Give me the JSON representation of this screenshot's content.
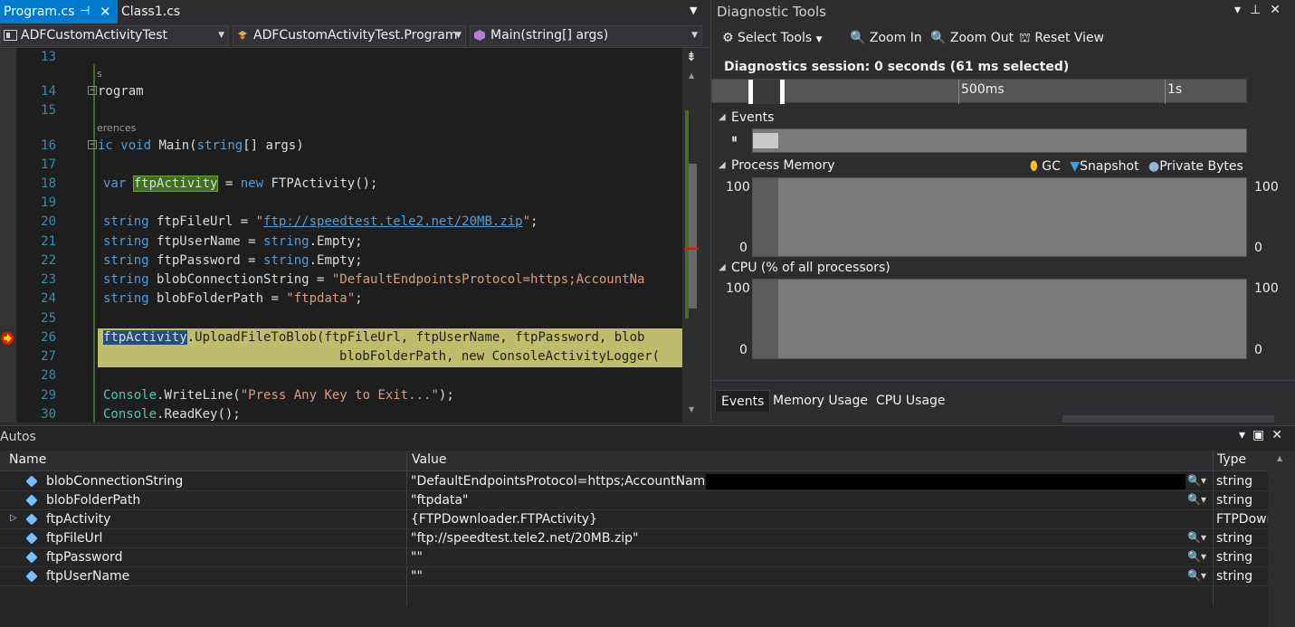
{
  "editor": {
    "tabs": [
      {
        "label": "Program.cs",
        "active": true
      },
      {
        "label": "Class1.cs",
        "active": false
      }
    ],
    "nav": {
      "project": "ADFCustomActivityTest",
      "class": "ADFCustomActivityTest.Program",
      "member": "Main(string[] args)"
    },
    "lines": [
      {
        "no": "13"
      },
      {
        "no": "14"
      },
      {
        "no": "15"
      },
      {
        "no": "16"
      },
      {
        "no": "17"
      },
      {
        "no": "18"
      },
      {
        "no": "19"
      },
      {
        "no": "20"
      },
      {
        "no": "21"
      },
      {
        "no": "22"
      },
      {
        "no": "23"
      },
      {
        "no": "24"
      },
      {
        "no": "25"
      },
      {
        "no": "26"
      },
      {
        "no": "27"
      },
      {
        "no": "28"
      },
      {
        "no": "29"
      },
      {
        "no": "30"
      }
    ],
    "code": {
      "l13_frag": "s",
      "l14": "rogram",
      "refs_frag": "erences",
      "l16_kw1": "ic",
      "l16_kw2": "void",
      "l16_rest": "Main(",
      "l16_kw3": "string",
      "l16_end": "[] args)",
      "l18_var": "var",
      "l18_id": "ftpActivity",
      "l18_eq": " = ",
      "l18_new": "new",
      "l18_rest": " FTPActivity();",
      "string_kw": "string",
      "l20_name": " ftpFileUrl = ",
      "l20_q1": "\"",
      "l20_url": "ftp://speedtest.tele2.net/20MB.zip",
      "l20_q2": "\"",
      "l20_end": ";",
      "l21_name": " ftpUserName = ",
      "l21_kw": "string",
      "l21_end": ".Empty;",
      "l22_name": " ftpPassword = ",
      "l22_kw": "string",
      "l22_end": ".Empty;",
      "l23_name": " blobConnectionString = ",
      "l23_str": "\"DefaultEndpointsProtocol=https;AccountNa",
      "l24_name": " blobFolderPath = ",
      "l24_str": "\"ftpdata\"",
      "l24_end": ";",
      "l26_id": "ftpActivity",
      "l26_rest": ".UploadFileToBlob(ftpFileUrl, ftpUserName, ftpPassword, blob",
      "l27": "blobFolderPath, new ConsoleActivityLogger(",
      "l29_cls": "Console",
      "l29_rest": ".WriteLine(",
      "l29_str": "\"Press Any Key to Exit...\"",
      "l29_end": ");",
      "l30_cls": "Console",
      "l30_rest": ".ReadKey();"
    }
  },
  "diag": {
    "title": "Diagnostic Tools",
    "toolbar": {
      "select_tools": "Select Tools",
      "zoom_in": "Zoom In",
      "zoom_out": "Zoom Out",
      "reset_view": "Reset View"
    },
    "session": "Diagnostics session: 0 seconds (61 ms selected)",
    "ruler": {
      "t1": "500ms",
      "t2": "1s"
    },
    "events_title": "Events",
    "memory": {
      "title": "Process Memory",
      "legend_gc": "GC",
      "legend_snapshot": "Snapshot",
      "legend_private": "Private Bytes",
      "ymax": "100",
      "ymin": "0",
      "ymax_r": "100",
      "ymin_r": "0"
    },
    "cpu": {
      "title": "CPU (% of all processors)",
      "ymax": "100",
      "ymin": "0",
      "ymax_r": "100",
      "ymin_r": "0"
    },
    "tabs": [
      {
        "label": "Events",
        "active": true
      },
      {
        "label": "Memory Usage",
        "active": false
      },
      {
        "label": "CPU Usage",
        "active": false
      }
    ],
    "colors": {
      "gc": "#f5c518",
      "snapshot": "#3c9eea",
      "private": "#8fb8d8"
    }
  },
  "autos": {
    "title": "Autos",
    "columns": {
      "name": "Name",
      "value": "Value",
      "type": "Type"
    },
    "rows": [
      {
        "name": "blobConnectionString",
        "value": "\"DefaultEndpointsProtocol=https;AccountName=",
        "type": "string",
        "expandable": false,
        "redacted": true
      },
      {
        "name": "blobFolderPath",
        "value": "\"ftpdata\"",
        "type": "string",
        "expandable": false,
        "redacted": false
      },
      {
        "name": "ftpActivity",
        "value": "{FTPDownloader.FTPActivity}",
        "type": "FTPDown",
        "expandable": true,
        "redacted": false
      },
      {
        "name": "ftpFileUrl",
        "value": "\"ftp://speedtest.tele2.net/20MB.zip\"",
        "type": "string",
        "expandable": false,
        "redacted": false
      },
      {
        "name": "ftpPassword",
        "value": "\"\"",
        "type": "string",
        "expandable": false,
        "redacted": false
      },
      {
        "name": "ftpUserName",
        "value": "\"\"",
        "type": "string",
        "expandable": false,
        "redacted": false
      }
    ]
  }
}
